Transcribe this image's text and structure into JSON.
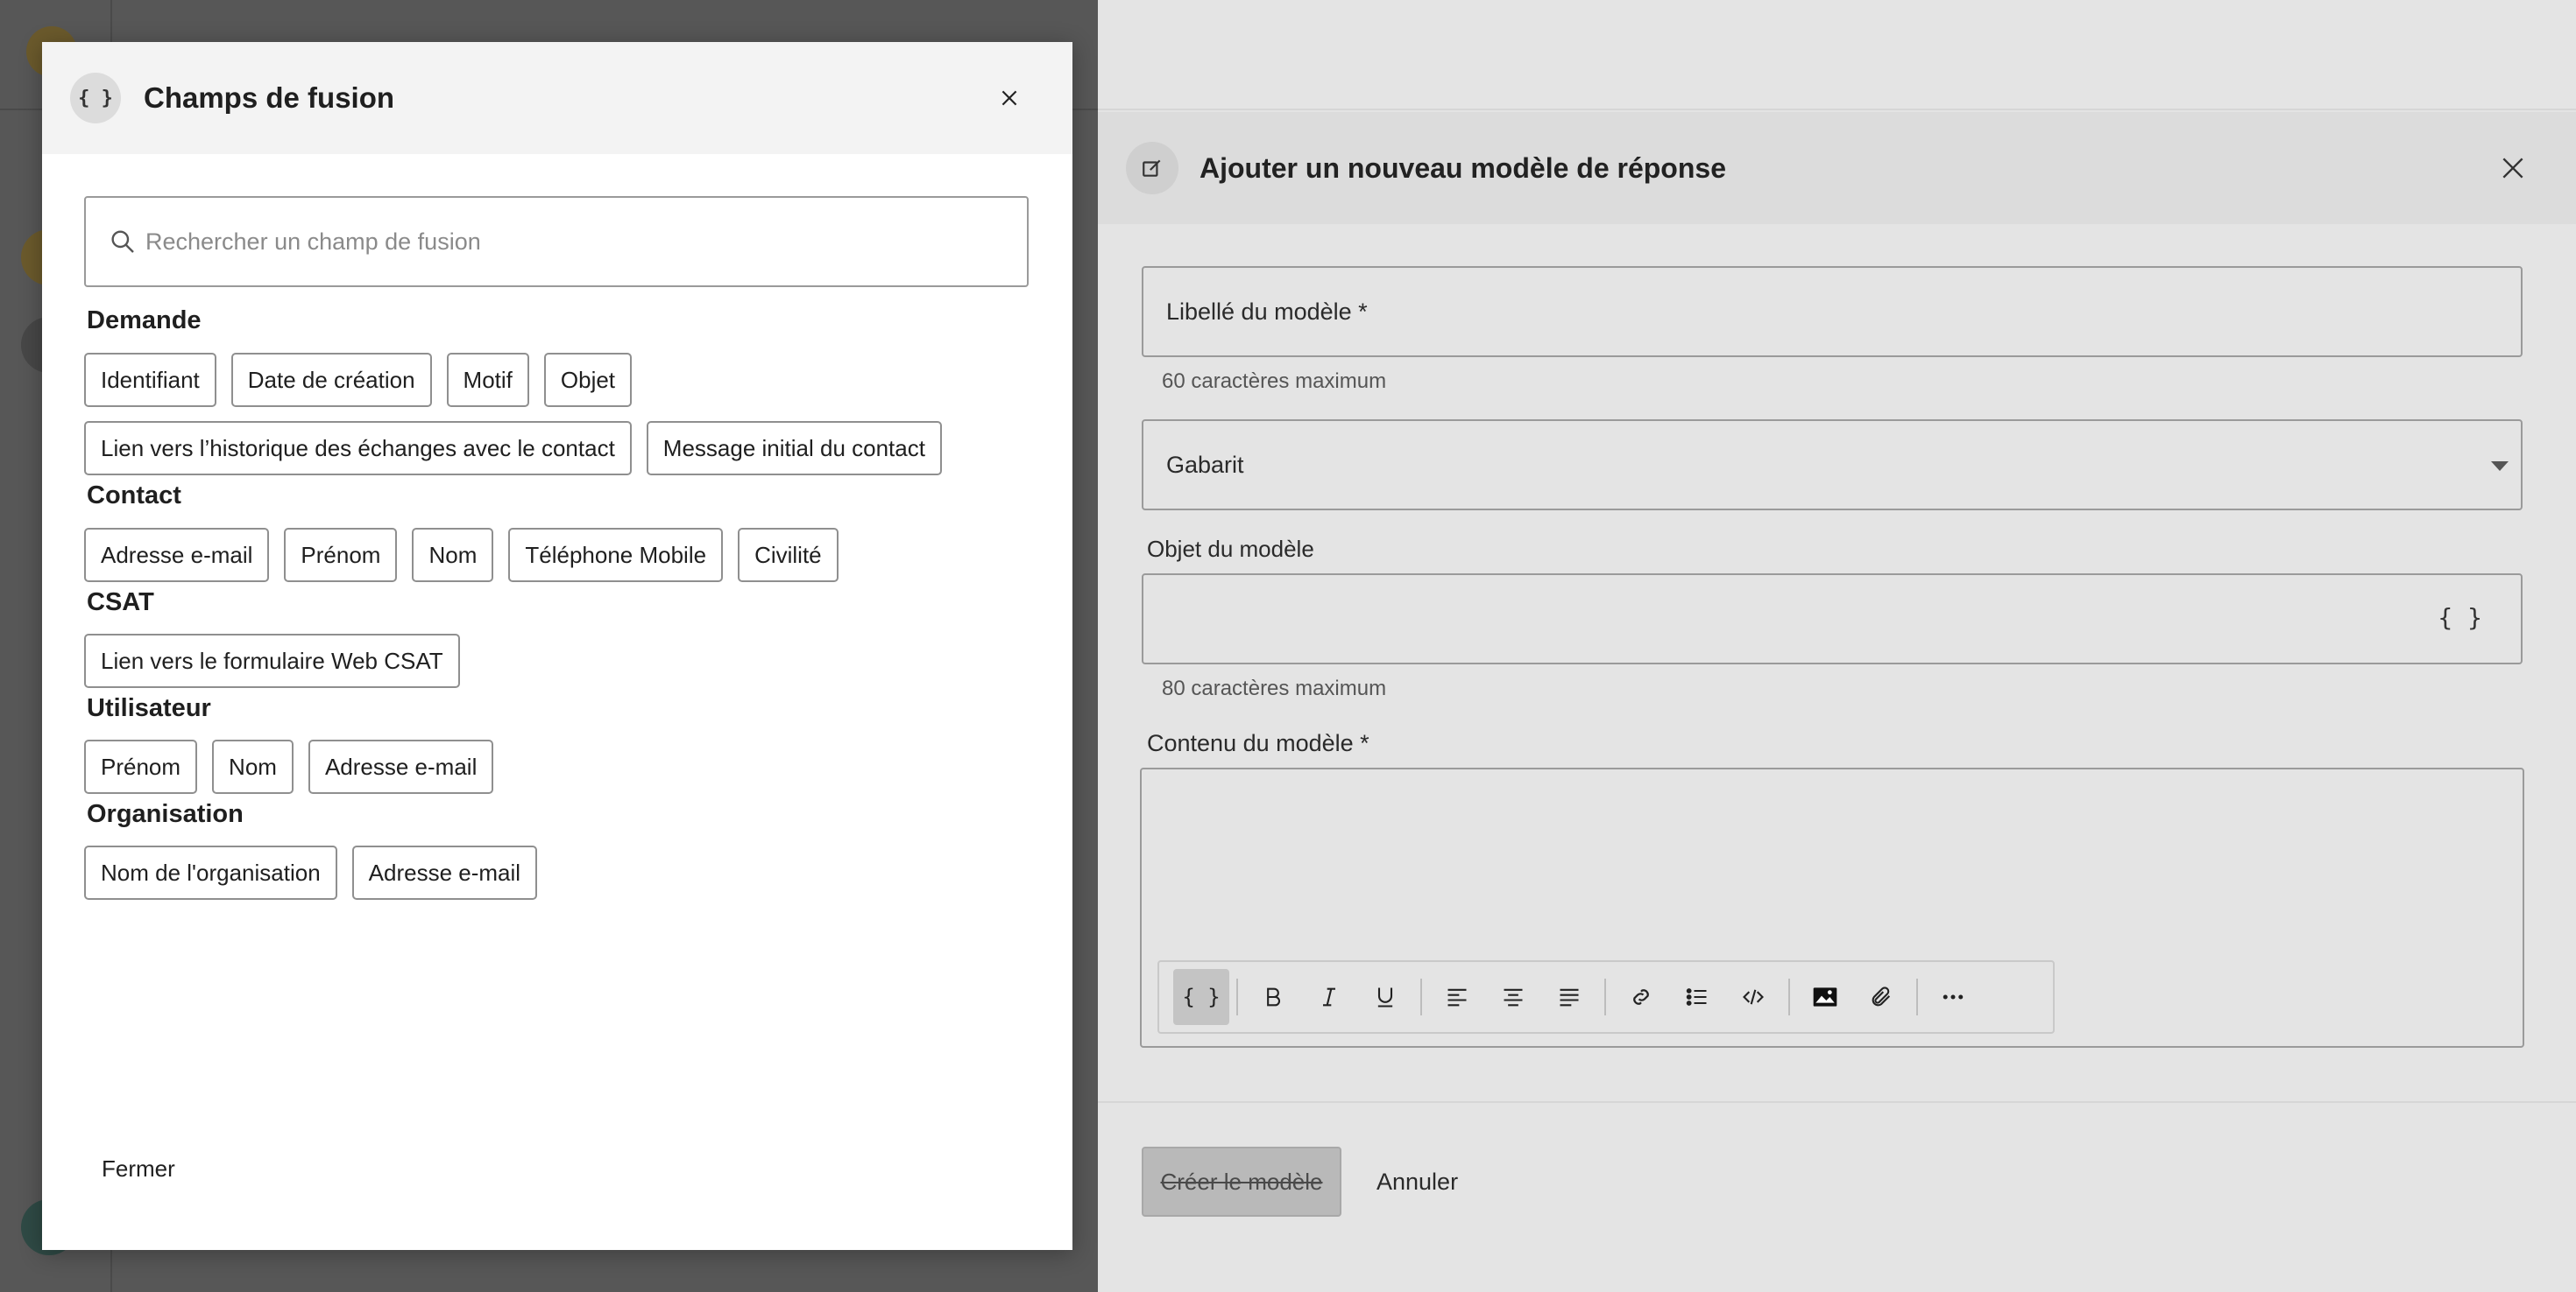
{
  "modal": {
    "title": "Champs de fusion",
    "icon": "braces-icon",
    "search_placeholder": "Rechercher un champ de fusion",
    "close_label": "Fermer",
    "sections": [
      {
        "title": "Demande",
        "rows": [
          [
            "Identifiant",
            "Date de création",
            "Motif",
            "Objet"
          ],
          [
            "Lien vers l’historique des échanges avec le contact",
            "Message initial du contact"
          ]
        ]
      },
      {
        "title": "Contact",
        "rows": [
          [
            "Adresse e-mail",
            "Prénom",
            "Nom",
            "Téléphone Mobile",
            "Civilité"
          ]
        ]
      },
      {
        "title": "CSAT",
        "rows": [
          [
            "Lien vers le formulaire Web CSAT"
          ]
        ]
      },
      {
        "title": "Utilisateur",
        "rows": [
          [
            "Prénom",
            "Nom",
            "Adresse e-mail"
          ]
        ]
      },
      {
        "title": "Organisation",
        "rows": [
          [
            "Nom de l'organisation",
            "Adresse e-mail"
          ]
        ]
      }
    ]
  },
  "drawer": {
    "title": "Ajouter un nouveau modèle de réponse",
    "icon": "edit-template-icon",
    "label_field": "Libellé du modèle *",
    "label_hint": "60 caractères maximum",
    "template_select": "Gabarit",
    "subject_label": "Objet du modèle",
    "subject_value": "",
    "subject_hint": "80 caractères maximum",
    "content_label": "Contenu du modèle *",
    "create_button": "Créer le modèle",
    "cancel_button": "Annuler",
    "toolbar": [
      "braces-icon",
      "bold-icon",
      "italic-icon",
      "underline-icon",
      "align-left-icon",
      "align-center-icon",
      "align-right-icon",
      "link-icon",
      "bullet-list-icon",
      "code-icon",
      "image-icon",
      "attachment-icon",
      "more-icon"
    ]
  },
  "colors": {
    "overlay": "#575757",
    "drawer_bg": "#e4e4e4",
    "modal_header": "#f3f3f3"
  }
}
